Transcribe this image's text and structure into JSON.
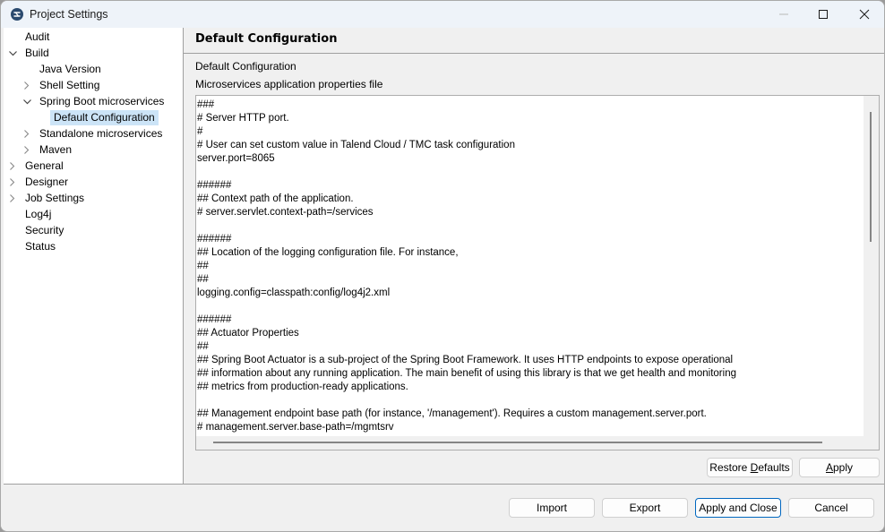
{
  "window": {
    "title": "Project Settings",
    "icon": "talend-app-icon",
    "controls": {
      "minimize": "minimize-icon",
      "maximize": "maximize-icon",
      "close": "close-icon"
    }
  },
  "sidebar": {
    "items": [
      {
        "label": "Audit",
        "level": 0,
        "arrow": "none"
      },
      {
        "label": "Build",
        "level": 0,
        "arrow": "expanded"
      },
      {
        "label": "Java Version",
        "level": 1,
        "arrow": "none"
      },
      {
        "label": "Shell Setting",
        "level": 1,
        "arrow": "collapsed"
      },
      {
        "label": "Spring Boot microservices",
        "level": 1,
        "arrow": "expanded"
      },
      {
        "label": "Default Configuration",
        "level": 2,
        "arrow": "none",
        "selected": true
      },
      {
        "label": "Standalone microservices",
        "level": 1,
        "arrow": "collapsed"
      },
      {
        "label": "Maven",
        "level": 1,
        "arrow": "collapsed"
      },
      {
        "label": "General",
        "level": 0,
        "arrow": "collapsed"
      },
      {
        "label": "Designer",
        "level": 0,
        "arrow": "collapsed"
      },
      {
        "label": "Job Settings",
        "level": 0,
        "arrow": "collapsed"
      },
      {
        "label": "Log4j",
        "level": 0,
        "arrow": "none"
      },
      {
        "label": "Security",
        "level": 0,
        "arrow": "none"
      },
      {
        "label": "Status",
        "level": 0,
        "arrow": "none"
      }
    ]
  },
  "content": {
    "title": "Default Configuration",
    "section_label": "Default Configuration",
    "editor_label": "Microservices application properties file",
    "editor_lines": [
      "###",
      "# Server HTTP port.",
      "#",
      "# User can set custom value in Talend Cloud / TMC task configuration",
      "server.port=8065",
      "",
      "######",
      "## Context path of the application.",
      "# server.servlet.context-path=/services",
      "",
      "######",
      "## Location of the logging configuration file. For instance,",
      "##",
      "##",
      "logging.config=classpath:config/log4j2.xml",
      "",
      "######",
      "## Actuator Properties",
      "##",
      "## Spring Boot Actuator is a sub-project of the Spring Boot Framework. It uses HTTP endpoints to expose operational",
      "## information about any running application. The main benefit of using this library is that we get health and monitoring",
      "## metrics from production-ready applications.",
      "",
      "## Management endpoint base path (for instance, '/management'). Requires a custom management.server.port.",
      "# management.server.base-path=/mgmtsrv"
    ]
  },
  "buttons": {
    "restore_defaults": {
      "pre": "Restore ",
      "mnemonic": "D",
      "post": "efaults"
    },
    "apply": {
      "pre": "",
      "mnemonic": "A",
      "post": "pply"
    },
    "import": "Import",
    "export": "Export",
    "apply_and_close": "Apply and Close",
    "cancel": "Cancel"
  }
}
